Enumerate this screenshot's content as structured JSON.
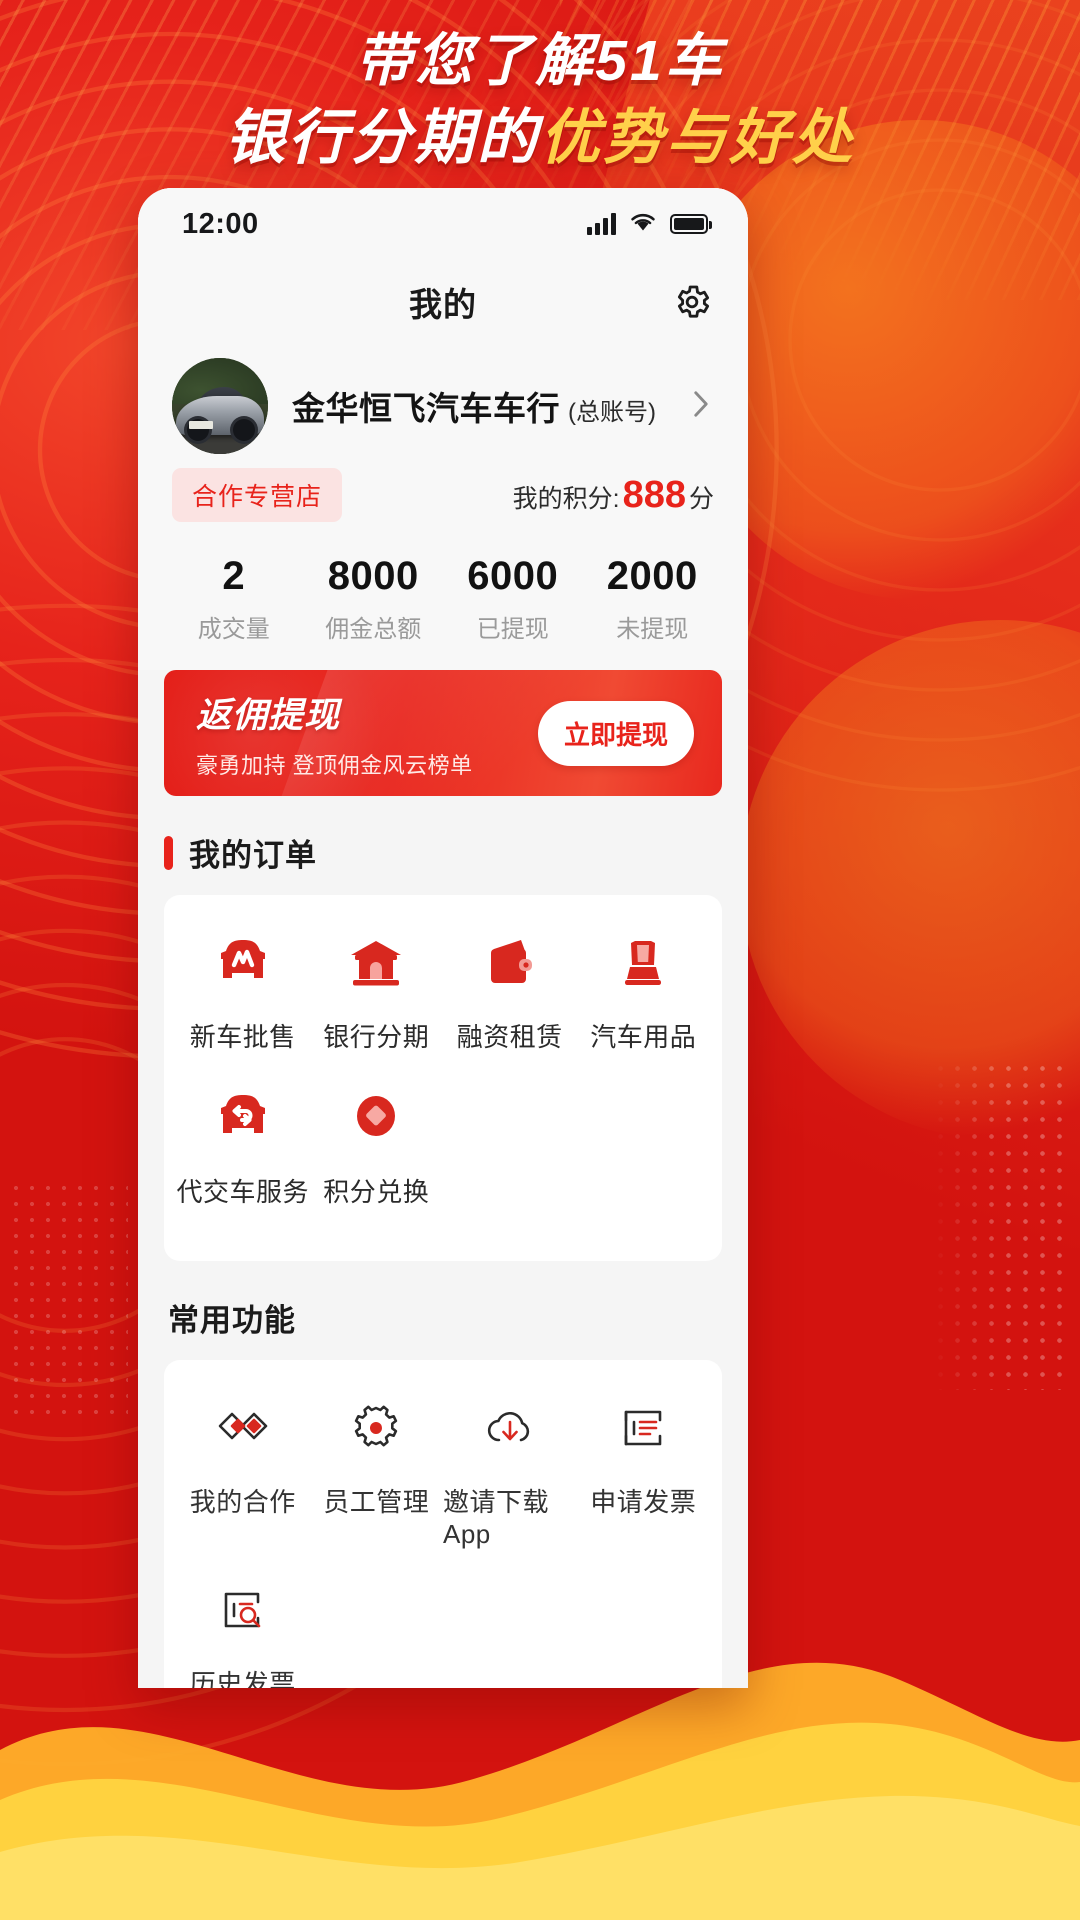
{
  "poster": {
    "title_line1": "带您了解51车",
    "title_line2_plain": "银行分期的",
    "title_line2_highlight": "优势与好处",
    "bg_color": "#e8241c",
    "highlight_color": "#ffd04a"
  },
  "status_bar": {
    "time": "12:00",
    "signal_icon": "signal-bars-icon",
    "wifi_icon": "wifi-icon",
    "battery_icon": "battery-icon"
  },
  "nav": {
    "title": "我的",
    "settings_icon": "gear-icon"
  },
  "profile": {
    "avatar_icon": "car-photo-avatar",
    "name": "金华恒飞汽车车行",
    "account_note": "(总账号)",
    "chevron_icon": "chevron-right-icon",
    "tag": "合作专营店",
    "points_label": "我的积分:",
    "points_value": "888",
    "points_unit": "分",
    "accent_color": "#e8231b"
  },
  "stats": [
    {
      "value": "2",
      "label": "成交量"
    },
    {
      "value": "8000",
      "label": "佣金总额"
    },
    {
      "value": "6000",
      "label": "已提现"
    },
    {
      "value": "2000",
      "label": "未提现"
    }
  ],
  "banner": {
    "title": "返佣提现",
    "subtitle": "豪勇加持 登顶佣金风云榜单",
    "button": "立即提现"
  },
  "orders_section": {
    "title": "我的订单",
    "items": [
      {
        "label": "新车批售",
        "icon": "car-front-icon"
      },
      {
        "label": "银行分期",
        "icon": "bank-building-icon"
      },
      {
        "label": "融资租赁",
        "icon": "wallet-icon"
      },
      {
        "label": "汽车用品",
        "icon": "car-seat-icon"
      },
      {
        "label": "代交车服务",
        "icon": "car-exchange-icon"
      },
      {
        "label": "积分兑换",
        "icon": "diamond-coin-icon"
      }
    ]
  },
  "functions_section": {
    "title": "常用功能",
    "items": [
      {
        "label": "我的合作",
        "icon": "handshake-icon"
      },
      {
        "label": "员工管理",
        "icon": "gear-people-icon"
      },
      {
        "label": "邀请下载App",
        "icon": "cloud-download-icon"
      },
      {
        "label": "申请发票",
        "icon": "invoice-icon"
      },
      {
        "label": "历史发票",
        "icon": "invoice-search-icon"
      }
    ]
  }
}
